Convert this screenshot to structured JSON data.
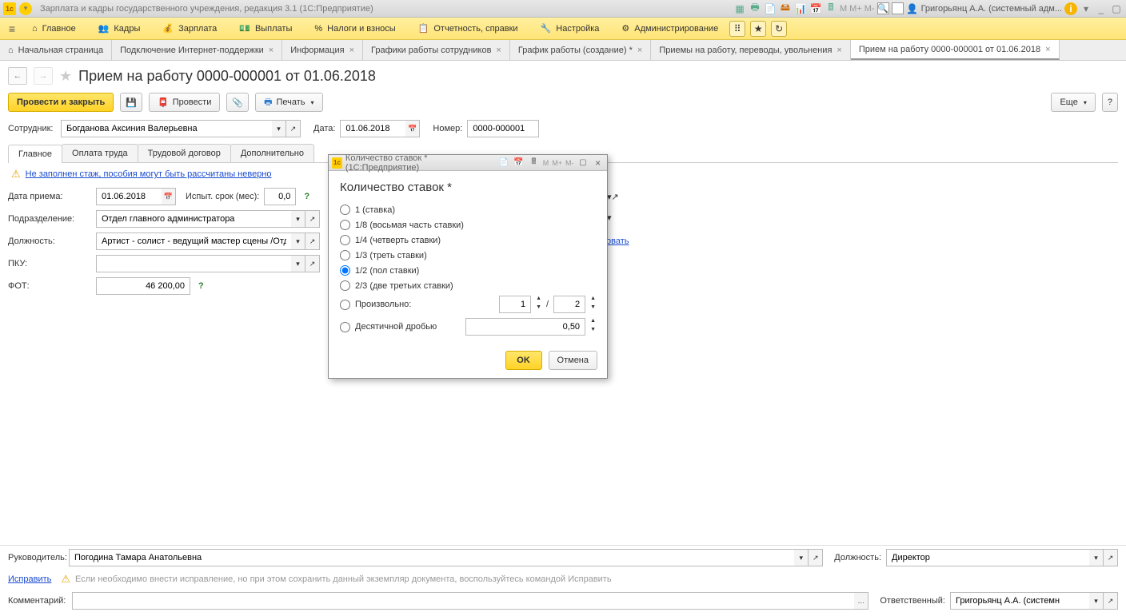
{
  "titlebar": {
    "appTitle": "Зарплата и кадры государственного учреждения, редакция 3.1  (1С:Предприятие)",
    "user": "Григорьянц А.А. (системный адм...",
    "m": "M",
    "mplus": "M+",
    "mminus": "M-"
  },
  "menu": {
    "items": [
      {
        "label": "Главное"
      },
      {
        "label": "Кадры"
      },
      {
        "label": "Зарплата"
      },
      {
        "label": "Выплаты"
      },
      {
        "label": "Налоги и взносы"
      },
      {
        "label": "Отчетность, справки"
      },
      {
        "label": "Настройка"
      },
      {
        "label": "Администрирование"
      }
    ]
  },
  "docTabs": [
    {
      "label": "Начальная страница",
      "closable": false,
      "home": true
    },
    {
      "label": "Подключение Интернет-поддержки",
      "closable": true
    },
    {
      "label": "Информация",
      "closable": true
    },
    {
      "label": "Графики работы сотрудников",
      "closable": true
    },
    {
      "label": "График работы (создание) *",
      "closable": true
    },
    {
      "label": "Приемы на работу, переводы, увольнения",
      "closable": true
    },
    {
      "label": "Прием на работу 0000-000001 от 01.06.2018",
      "closable": true,
      "active": true
    }
  ],
  "page": {
    "title": "Прием на работу 0000-000001 от 01.06.2018"
  },
  "toolbar": {
    "postClose": "Провести и закрыть",
    "post": "Провести",
    "print": "Печать",
    "more": "Еще"
  },
  "form": {
    "employeeLbl": "Сотрудник:",
    "employee": "Богданова Аксиния Валерьевна",
    "dateLbl": "Дата:",
    "date": "01.06.2018",
    "numberLbl": "Номер:",
    "number": "0000-000001",
    "subtabs": [
      "Главное",
      "Оплата труда",
      "Трудовой договор",
      "Дополнительно"
    ],
    "warning": "Не заполнен стаж, пособия могут быть рассчитаны неверно",
    "hireDateLbl": "Дата приема:",
    "hireDate": "01.06.2018",
    "probLbl": "Испыт. срок (мес):",
    "probVal": "0,0",
    "deptLbl": "Подразделение:",
    "dept": "Отдел главного администратора",
    "posLbl": "Должность:",
    "pos": "Артист - солист - ведущий мастер сцены /Отдел главного а",
    "pkuLbl": "ПКУ:",
    "pku": "",
    "fotLbl": "ФОТ:",
    "fot": "46 200,00",
    "editLink": "овать"
  },
  "footer": {
    "headLbl": "Руководитель:",
    "head": "Погодина Тамара Анатольевна",
    "posLbl": "Должность:",
    "pos": "Директор",
    "fix": "Исправить",
    "fixHint": "Если необходимо внести исправление, но при этом сохранить данный экземпляр документа, воспользуйтесь командой Исправить",
    "commentLbl": "Комментарий:",
    "comment": "",
    "respLbl": "Ответственный:",
    "resp": "Григорьянц А.А. (системн"
  },
  "modal": {
    "winTitle": "Количество ставок *  (1С:Предприятие)",
    "heading": "Количество ставок *",
    "opts": [
      "1 (ставка)",
      "1/8 (восьмая часть ставки)",
      "1/4 (четверть ставки)",
      "1/3 (треть ставки)",
      "1/2 (пол ставки)",
      "2/3 (две третьих ставки)"
    ],
    "arbitrary": "Произвольно:",
    "arbA": "1",
    "arbSep": "/",
    "arbB": "2",
    "decimal": "Десятичной дробью",
    "decVal": "0,50",
    "ok": "OK",
    "cancel": "Отмена",
    "m": "M",
    "mplus": "M+",
    "mminus": "M-"
  }
}
